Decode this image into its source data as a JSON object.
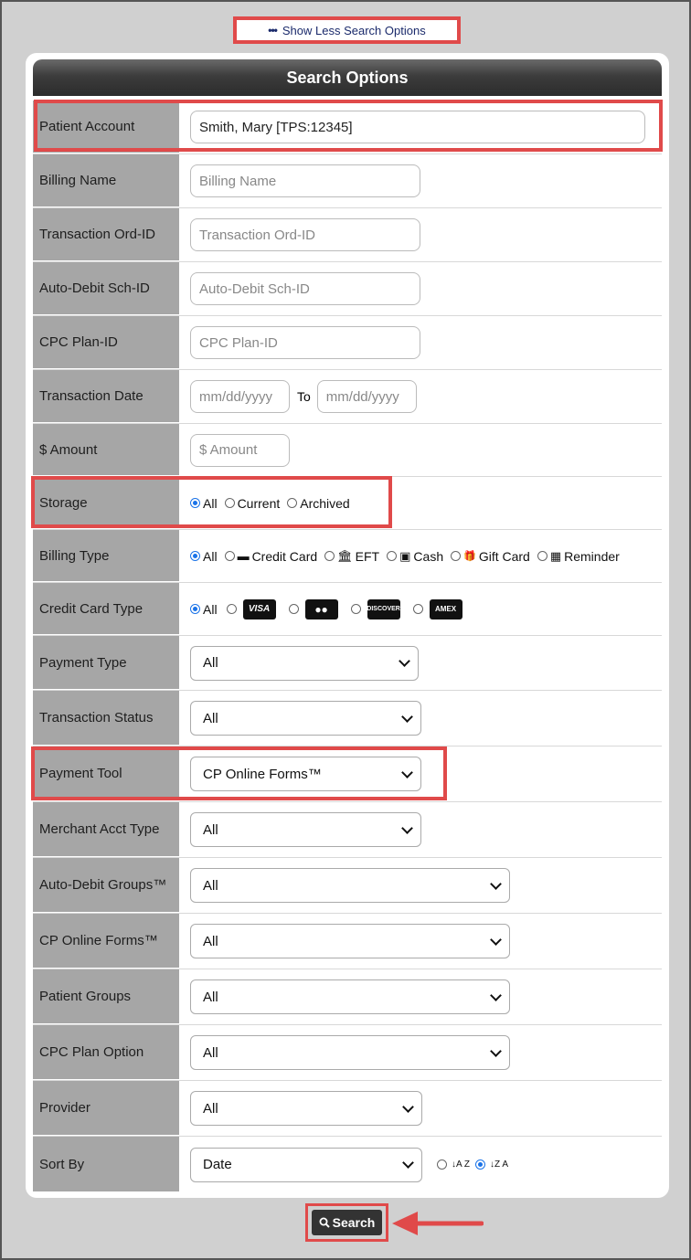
{
  "toggle": {
    "dots": "•••",
    "label": "Show Less Search Options"
  },
  "panel": {
    "title": "Search Options"
  },
  "labels": {
    "patient_account": "Patient Account",
    "billing_name": "Billing Name",
    "transaction_ord_id": "Transaction Ord-ID",
    "auto_debit_sch_id": "Auto-Debit Sch-ID",
    "cpc_plan_id": "CPC Plan-ID",
    "transaction_date": "Transaction Date",
    "amount": "$ Amount",
    "storage": "Storage",
    "billing_type": "Billing Type",
    "credit_card_type": "Credit Card Type",
    "payment_type": "Payment Type",
    "transaction_status": "Transaction Status",
    "payment_tool": "Payment Tool",
    "merchant_acct_type": "Merchant Acct Type",
    "auto_debit_groups": "Auto-Debit Groups™",
    "cp_online_forms": "CP Online Forms™",
    "patient_groups": "Patient Groups",
    "cpc_plan_option": "CPC Plan Option",
    "provider": "Provider",
    "sort_by": "Sort By"
  },
  "inputs": {
    "patient_account_value": "Smith, Mary [TPS:12345]",
    "billing_name_placeholder": "Billing Name",
    "transaction_ord_id_placeholder": "Transaction Ord-ID",
    "auto_debit_sch_id_placeholder": "Auto-Debit Sch-ID",
    "cpc_plan_id_placeholder": "CPC Plan-ID",
    "date_from_placeholder": "mm/dd/yyyy",
    "date_to_placeholder": "mm/dd/yyyy",
    "date_to_label": "To",
    "amount_placeholder": "$ Amount"
  },
  "storage_options": {
    "all": "All",
    "current": "Current",
    "archived": "Archived"
  },
  "billing_type_options": {
    "all": "All",
    "credit_card": "Credit Card",
    "eft": "EFT",
    "cash": "Cash",
    "gift_card": "Gift Card",
    "reminder": "Reminder"
  },
  "credit_card_options": {
    "all": "All",
    "visa": "VISA",
    "mastercard": "●●",
    "discover": "DISCOVER",
    "amex": "AMEX"
  },
  "selects": {
    "payment_type": "All",
    "transaction_status": "All",
    "payment_tool": "CP Online Forms™",
    "merchant_acct_type": "All",
    "auto_debit_groups": "All",
    "cp_online_forms": "All",
    "patient_groups": "All",
    "cpc_plan_option": "All",
    "provider": "All",
    "sort_by": "Date"
  },
  "sort_icons": {
    "asc": "↓A Z",
    "desc": "↓Z A"
  },
  "search_button": {
    "label": "Search"
  },
  "icons": {
    "credit_card": "▬",
    "eft": "🏛",
    "cash": "▣",
    "gift_card": "🎁",
    "reminder": "▦",
    "search": "🔍"
  },
  "colors": {
    "highlight": "#e04a4a",
    "header": "#3c3c3c",
    "label_bg": "#a6a6a6"
  }
}
